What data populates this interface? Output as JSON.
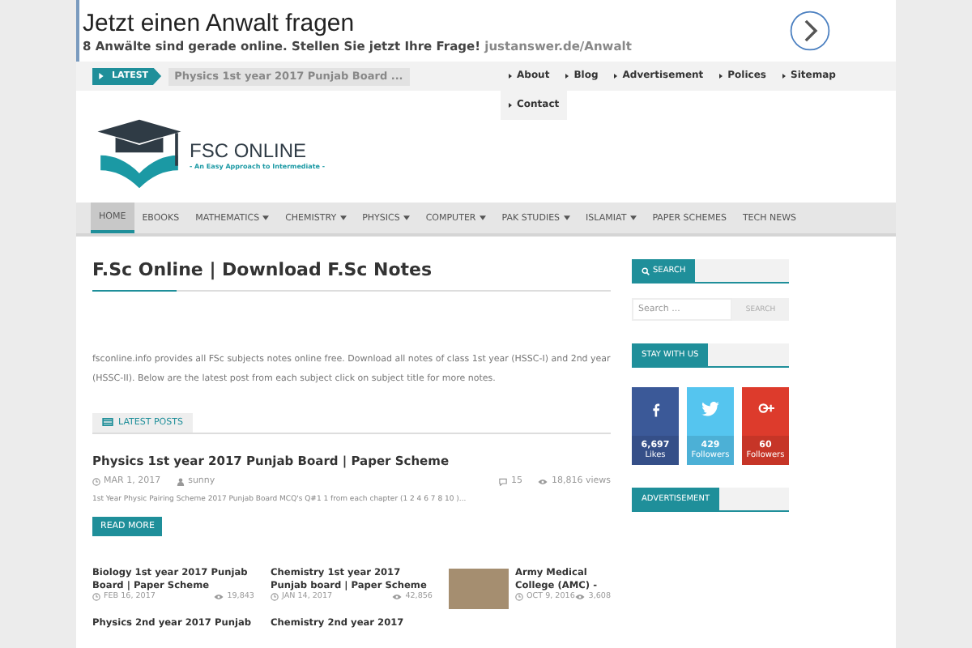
{
  "ad": {
    "headline": "Jetzt einen Anwalt fragen",
    "text": "8 Anwälte sind gerade online. Stellen Sie jetzt Ihre Frage!",
    "url": "justanswer.de/Anwalt"
  },
  "top_bar": {
    "latest_label": "LATEST",
    "latest_title": "Physics 1st year 2017 Punjab Board ...",
    "links": [
      "About",
      "Blog",
      "Advertisement",
      "Polices",
      "Sitemap",
      "Contact"
    ]
  },
  "logo": {
    "name": "FSC ONLINE",
    "tagline": "- An Easy Approach to Intermediate -"
  },
  "nav": [
    {
      "label": "HOME",
      "selected": true,
      "dropdown": false
    },
    {
      "label": "EBOOKS",
      "selected": false,
      "dropdown": false
    },
    {
      "label": "MATHEMATICS",
      "selected": false,
      "dropdown": true
    },
    {
      "label": "CHEMISTRY",
      "selected": false,
      "dropdown": true
    },
    {
      "label": "PHYSICS",
      "selected": false,
      "dropdown": true
    },
    {
      "label": "COMPUTER",
      "selected": false,
      "dropdown": true
    },
    {
      "label": "PAK STUDIES",
      "selected": false,
      "dropdown": true
    },
    {
      "label": "ISLAMIAT",
      "selected": false,
      "dropdown": true
    },
    {
      "label": "PAPER SCHEMES",
      "selected": false,
      "dropdown": false
    },
    {
      "label": "TECH NEWS",
      "selected": false,
      "dropdown": false
    }
  ],
  "main": {
    "title": "F.Sc Online | Download F.Sc Notes",
    "intro": "fsconline.info provides all FSc subjects notes online free. Download all notes of class 1st year (HSSC-I) and 2nd year (HSSC-II). Below are the latest post from each subject click on subject title for more notes.",
    "section": "LATEST POSTS",
    "featured": {
      "title": "Physics 1st year 2017 Punjab Board | Paper Scheme",
      "date": "MAR 1, 2017",
      "author": "sunny",
      "comments": "15",
      "views": "18,816 views",
      "excerpt": "1st Year Physic Pairing Scheme 2017 Punjab Board MCQ's Q#1 1 from each chapter (1 2 4 6 7 8 10 )...",
      "button": "READ MORE"
    },
    "posts": [
      {
        "title": "Biology 1st year 2017 Punjab Board | Paper Scheme",
        "date": "FEB 16, 2017",
        "views": "19,843",
        "thumb": false
      },
      {
        "title": "Chemistry 1st year 2017 Punjab board | Paper Scheme",
        "date": "JAN 14, 2017",
        "views": "42,856",
        "thumb": false
      },
      {
        "title": "Army Medical College (AMC) -",
        "date": "OCT 9, 2016",
        "views": "3,608",
        "thumb": true
      },
      {
        "title": "Physics 2nd year 2017 Punjab",
        "thumb": false
      },
      {
        "title": "Chemistry 2nd year 2017",
        "thumb": false
      }
    ]
  },
  "sidebar": {
    "search_title": "SEARCH",
    "search_placeholder": "Search ...",
    "search_button": "SEARCH",
    "stay_title": "STAY WITH US",
    "social": [
      {
        "kind": "facebook",
        "count": "6,697",
        "label": "Likes",
        "color": "#3b5998"
      },
      {
        "kind": "twitter",
        "count": "429",
        "label": "Followers",
        "color": "#55c5ef"
      },
      {
        "kind": "gplus",
        "count": "60",
        "label": "Followers",
        "color": "#dd3b2c"
      }
    ],
    "ad_title": "ADVERTISEMENT"
  }
}
